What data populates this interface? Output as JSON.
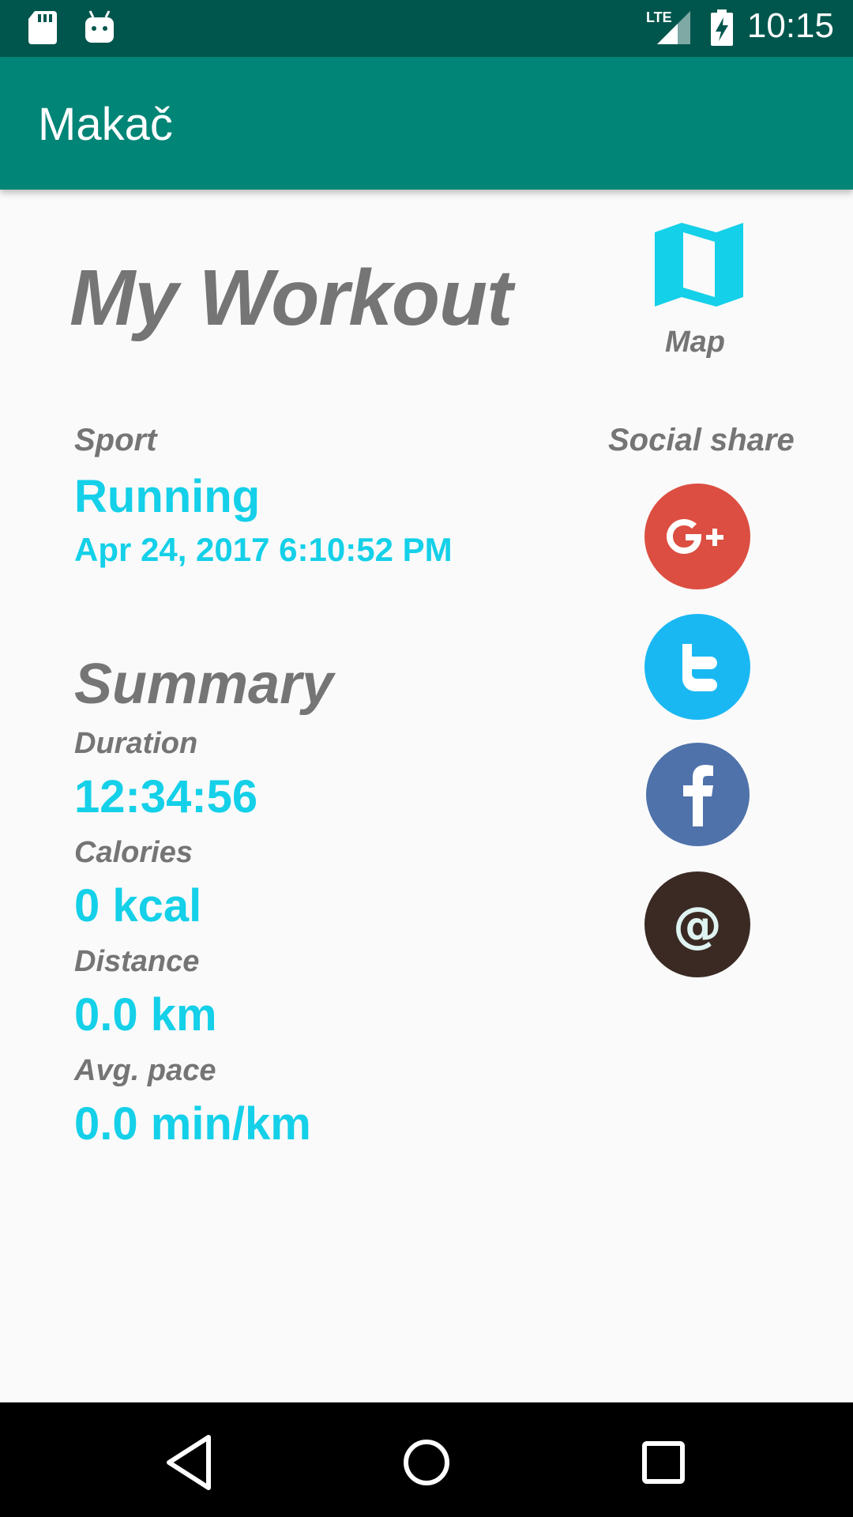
{
  "status_bar": {
    "time": "10:15",
    "network": "LTE",
    "icons": [
      "sd-card-icon",
      "android-debug-icon",
      "lte-signal-icon",
      "battery-charging-icon"
    ]
  },
  "app_bar": {
    "title": "Makač"
  },
  "workout": {
    "title": "My Workout",
    "map_label": "Map",
    "sport_label": "Sport",
    "sport_value": "Running",
    "date": "Apr 24, 2017 6:10:52 PM"
  },
  "summary": {
    "title": "Summary",
    "duration_label": "Duration",
    "duration_value": "12:34:56",
    "calories_label": "Calories",
    "calories_value": "0 kcal",
    "distance_label": "Distance",
    "distance_value": "0.0 km",
    "pace_label": "Avg. pace",
    "pace_value": "0.0 min/km"
  },
  "social": {
    "label": "Social share",
    "buttons": [
      {
        "name": "google-plus",
        "color": "#dc4e41"
      },
      {
        "name": "twitter",
        "color": "#1ab8f3"
      },
      {
        "name": "facebook",
        "color": "#4f72aa"
      },
      {
        "name": "email",
        "color": "#3b2a24"
      }
    ]
  },
  "colors": {
    "primary": "#008577",
    "primary_dark": "#00564d",
    "accent": "#14d0e8",
    "label_gray": "#757575"
  },
  "nav_bar": {
    "icons": [
      "back-icon",
      "home-icon",
      "recents-icon"
    ]
  }
}
